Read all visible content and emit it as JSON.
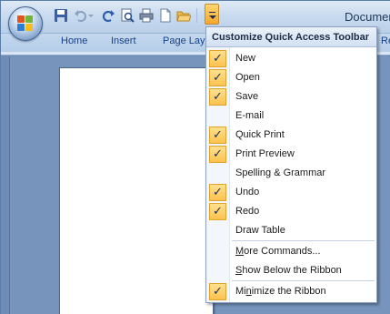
{
  "window": {
    "title": "Documen"
  },
  "quick_access": {
    "icons": [
      "save-icon",
      "undo-icon",
      "redo-icon",
      "print-preview-icon",
      "quick-print-icon",
      "new-icon",
      "open-icon"
    ]
  },
  "tabs": [
    {
      "label": "Home"
    },
    {
      "label": "Insert"
    },
    {
      "label": "Page Layo"
    },
    {
      "label": "Re"
    }
  ],
  "menu": {
    "title": "Customize Quick Access Toolbar",
    "items": [
      {
        "label": "New",
        "checked": true
      },
      {
        "label": "Open",
        "checked": true
      },
      {
        "label": "Save",
        "checked": true
      },
      {
        "label": "E-mail",
        "checked": false
      },
      {
        "label": "Quick Print",
        "checked": true
      },
      {
        "label": "Print Preview",
        "checked": true
      },
      {
        "label": "Spelling & Grammar",
        "checked": false
      },
      {
        "label": "Undo",
        "checked": true
      },
      {
        "label": "Redo",
        "checked": true
      },
      {
        "label": "Draw Table",
        "checked": false
      }
    ],
    "more_commands": {
      "label": "More Commands...",
      "access_key": "M"
    },
    "show_below": {
      "label": "Show Below the Ribbon",
      "access_key": "S"
    },
    "minimize": {
      "label": "Minimize the Ribbon",
      "access_key": "n",
      "checked": true
    }
  },
  "colors": {
    "accent": "#f7a631",
    "check_bg": "#fcc24e",
    "tab_text": "#15428b",
    "frame": "#6b8fba"
  }
}
